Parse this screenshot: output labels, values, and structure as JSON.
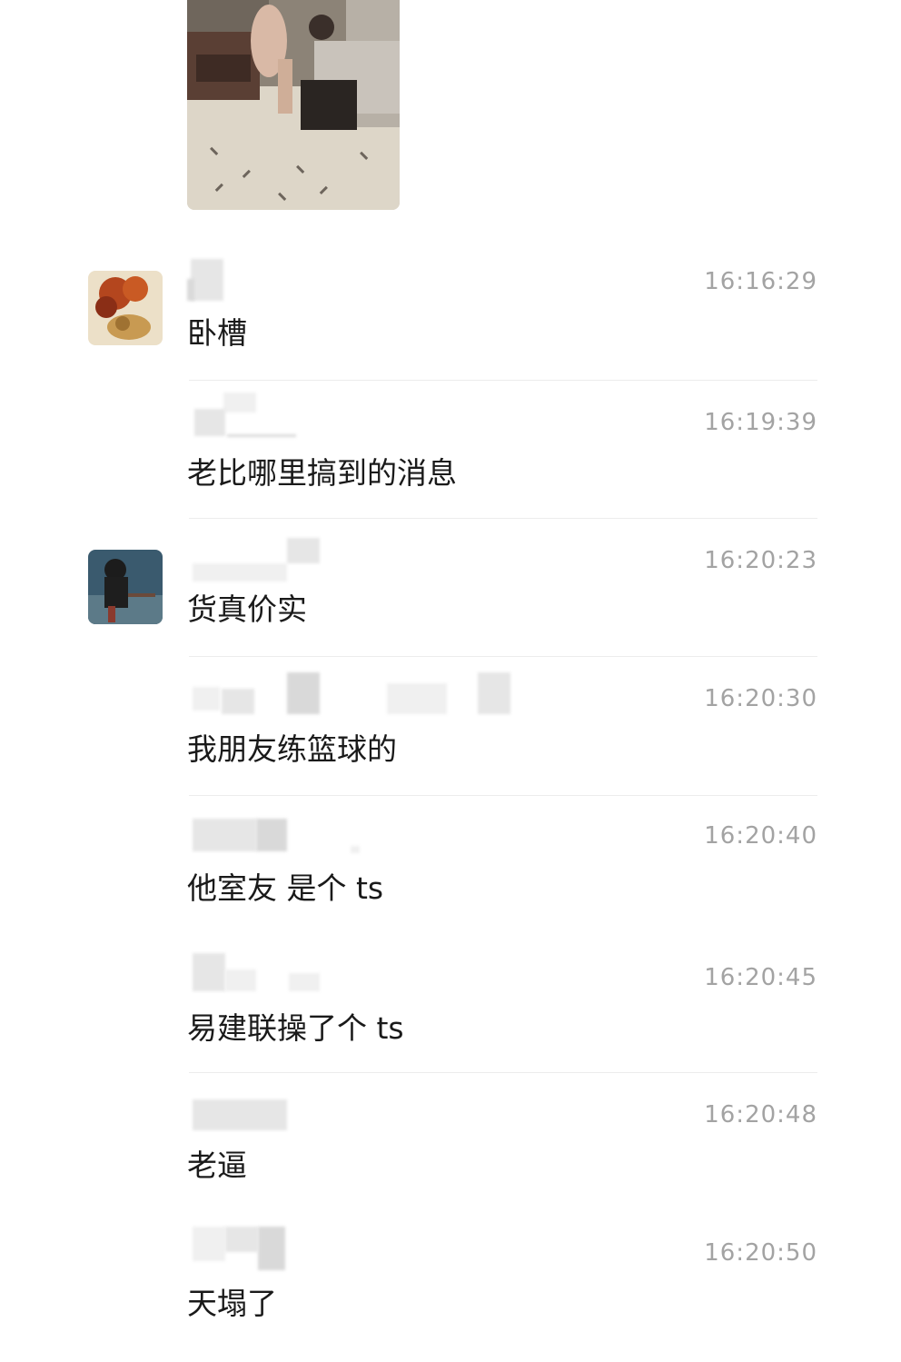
{
  "messages": [
    {
      "time": "16:16:29",
      "text": "卧槽"
    },
    {
      "time": "16:19:39",
      "text": "老比哪里搞到的消息"
    },
    {
      "time": "16:20:23",
      "text": "货真价实"
    },
    {
      "time": "16:20:30",
      "text": "我朋友练篮球的"
    },
    {
      "time": "16:20:40",
      "text": "他室友 是个 ts"
    },
    {
      "time": "16:20:45",
      "text": "易建联操了个 ts"
    },
    {
      "time": "16:20:48",
      "text": "老逼"
    },
    {
      "time": "16:20:50",
      "text": "天塌了"
    }
  ]
}
